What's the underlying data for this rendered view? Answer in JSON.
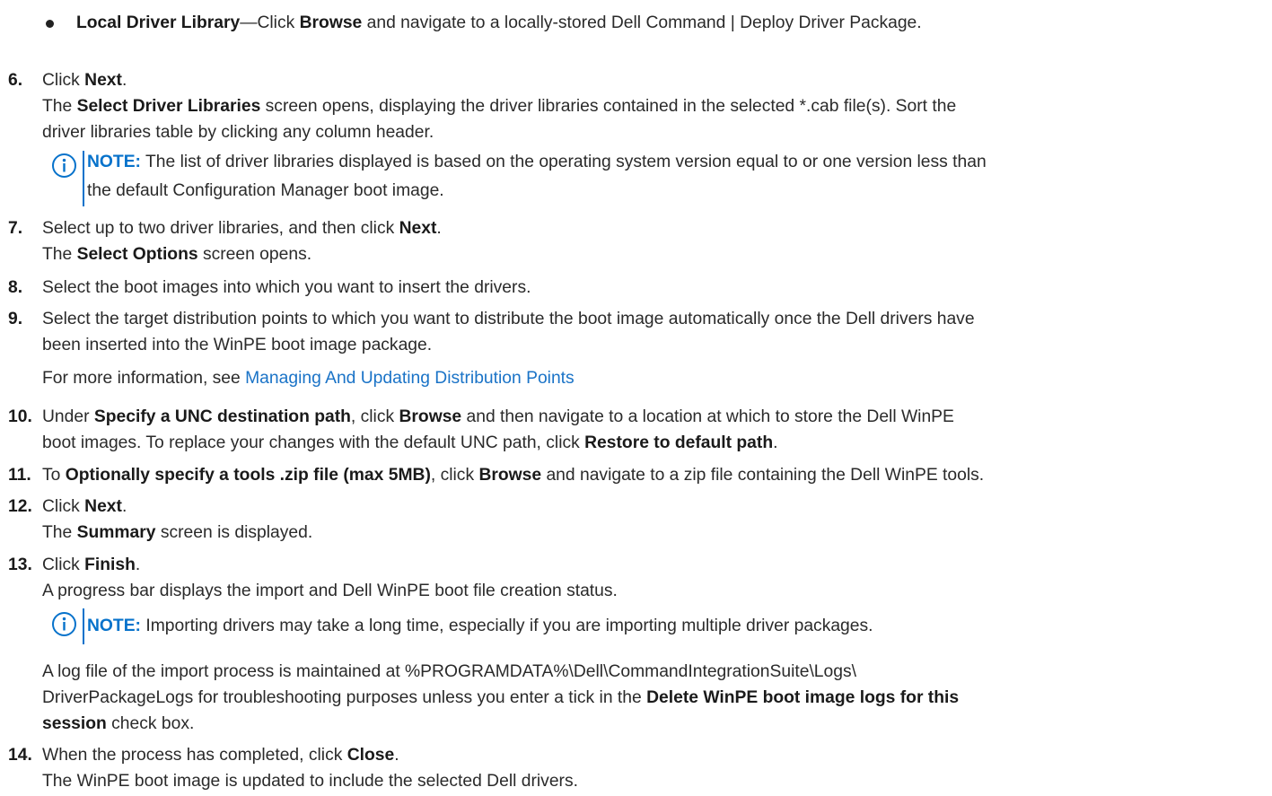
{
  "bullet": {
    "label": "Local Driver Library",
    "dash": "—Click ",
    "browse": "Browse",
    "rest": " and navigate to a locally-stored Dell Command | Deploy Driver Package."
  },
  "step6": {
    "num": "6.",
    "t1": "Click ",
    "b1": "Next",
    "t2": ".",
    "l2a": "The ",
    "l2b": "Select Driver Libraries",
    "l2c": " screen opens, displaying the driver libraries contained in the selected *.cab file(s). Sort the",
    "l3": "driver libraries table by clicking any column header.",
    "note_label": "NOTE:",
    "note_l1": " The list of driver libraries displayed is based on the operating system version equal to or one version less than",
    "note_l2": "the default Configuration Manager boot image."
  },
  "step7": {
    "num": "7.",
    "t1": "Select up to two driver libraries, and then click ",
    "b1": "Next",
    "t2": ".",
    "l2a": "The ",
    "l2b": "Select Options",
    "l2c": " screen opens."
  },
  "step8": {
    "num": "8.",
    "text": "Select the boot images into which you want to insert the drivers."
  },
  "step9": {
    "num": "9.",
    "l1": "Select the target distribution points to which you want to distribute the boot image automatically once the Dell drivers have",
    "l2": "been inserted into the WinPE boot image package.",
    "more_prefix": "For more information, see ",
    "more_link": "Managing And Updating Distribution Points"
  },
  "step10": {
    "num": "10.",
    "a": "Under ",
    "b": "Specify a UNC destination path",
    "c": ", click ",
    "d": "Browse",
    "e": " and then navigate to a location at which to store the Dell WinPE",
    "l2a": "boot images. To replace your changes with the default UNC path, click ",
    "l2b": "Restore to default path",
    "l2c": "."
  },
  "step11": {
    "num": "11.",
    "a": "To ",
    "b": "Optionally specify a tools .zip file (max 5MB)",
    "c": ", click ",
    "d": "Browse",
    "e": " and navigate to a zip file containing the Dell WinPE tools."
  },
  "step12": {
    "num": "12.",
    "t1": "Click ",
    "b1": "Next",
    "t2": ".",
    "l2a": "The ",
    "l2b": "Summary",
    "l2c": " screen is displayed."
  },
  "step13": {
    "num": "13.",
    "t1": "Click ",
    "b1": "Finish",
    "t2": ".",
    "l2": "A progress bar displays the import and Dell WinPE boot file creation status.",
    "note_label": "NOTE:",
    "note_text": " Importing drivers may take a long time, especially if you are importing multiple driver packages.",
    "log_l1": "A log file of the import process is maintained at %PROGRAMDATA%\\Dell\\CommandIntegrationSuite\\Logs\\",
    "log_l2a": "DriverPackageLogs for troubleshooting purposes unless you enter a tick in the ",
    "log_l2b": "Delete WinPE boot image logs for this",
    "log_l3a": "session",
    "log_l3b": " check box."
  },
  "step14": {
    "num": "14.",
    "t1": "When the process has completed, click ",
    "b1": "Close",
    "t2": ".",
    "l2": "The WinPE boot image is updated to include the selected Dell drivers."
  }
}
